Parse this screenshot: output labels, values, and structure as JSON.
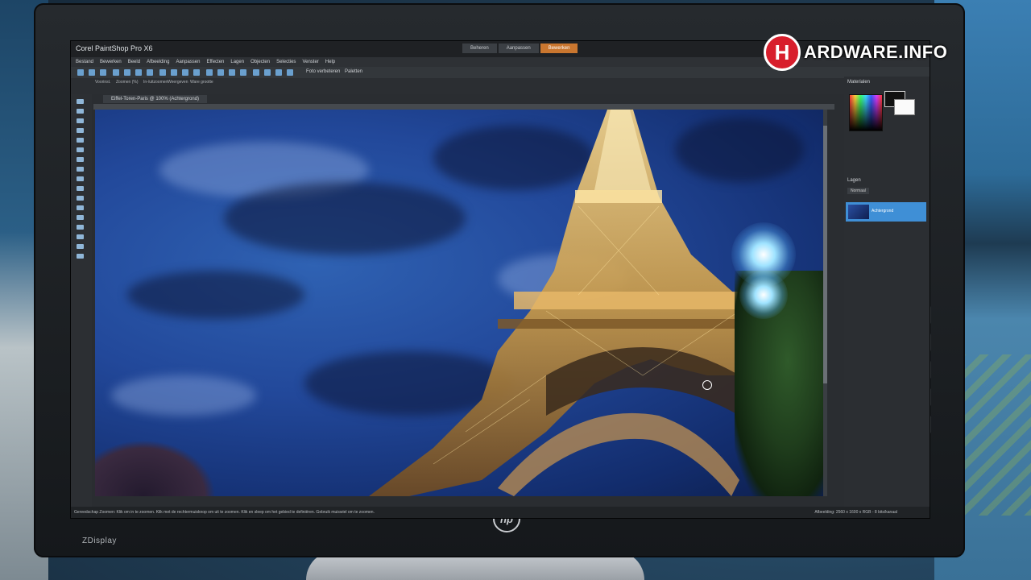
{
  "app": {
    "title": "Corel PaintShop Pro X6",
    "mode_tabs": [
      "Beheren",
      "Aanpassen",
      "Bewerken"
    ],
    "active_mode_tab": "Bewerken"
  },
  "menubar": [
    "Bestand",
    "Bewerken",
    "Beeld",
    "Afbeelding",
    "Aanpassen",
    "Effecten",
    "Lagen",
    "Objecten",
    "Selecties",
    "Venster",
    "Help"
  ],
  "toolbar": {
    "photo_edit_label": "Foto verbeteren",
    "palettes_label": "Paletten"
  },
  "options_bar": {
    "labels": [
      "Voorinst.",
      "Zoomen (%)",
      "In-/uitzoomen",
      "Weergeven",
      "Ware grootte"
    ]
  },
  "document": {
    "tab_label": "Eiffel-Toren-Paris @ 100% (Achtergrond)"
  },
  "right_panel": {
    "materials_header": "Materialen",
    "layers_header": "Lagen",
    "layer_mode": "Normaal",
    "layer_name": "Achtergrond"
  },
  "statusbar": {
    "hint": "Gereedschap Zoomen: Klik om in te zoomen. Klik met de rechtermuisknop om uit te zoomen. Klik en sleep om het gebied te definiëren. Gebruik muiswiel om te zoomen.",
    "info": "Afbeelding: 2560 x 1600 x RGB - 8 bits/kanaal"
  },
  "monitor": {
    "brand": "hp",
    "model": "ZDisplay"
  },
  "watermark": {
    "letter": "H",
    "text": "ARDWARE.INFO",
    "color": "#d81e2c"
  },
  "icons": [
    "zoom-cursor-icon",
    "color-picker",
    "layer-thumbnail"
  ]
}
